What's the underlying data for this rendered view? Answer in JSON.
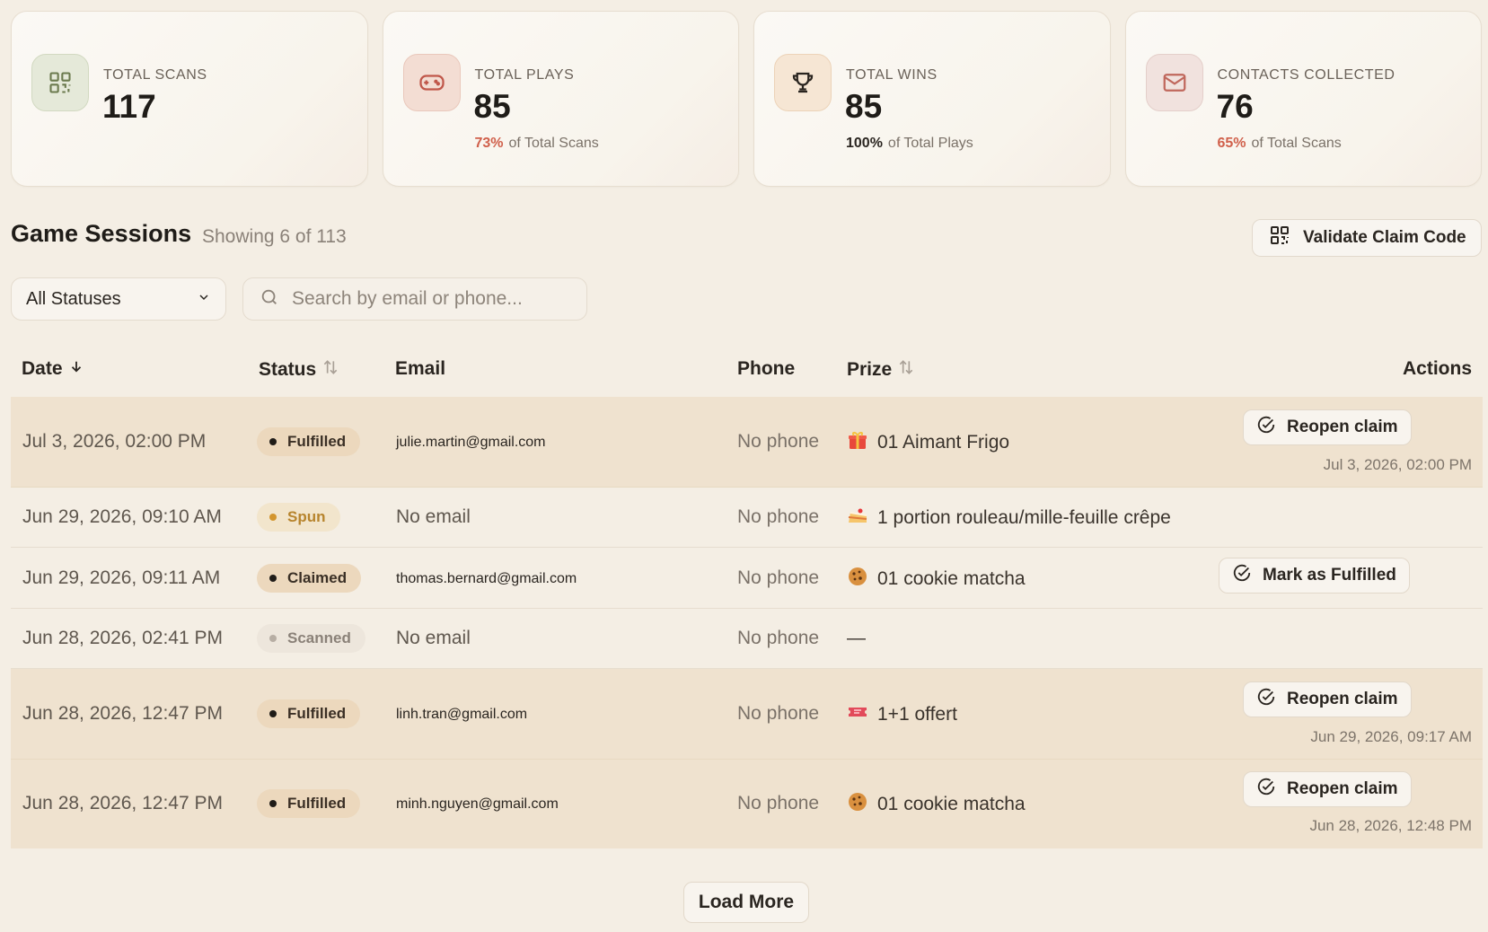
{
  "stats": [
    {
      "label": "TOTAL SCANS",
      "value": "117",
      "pct": "",
      "sub": "",
      "icon": "qr-code-icon"
    },
    {
      "label": "TOTAL PLAYS",
      "value": "85",
      "pct": "73%",
      "sub": "of Total Scans",
      "icon": "gamepad-icon"
    },
    {
      "label": "TOTAL WINS",
      "value": "85",
      "pct": "100%",
      "sub": "of Total Plays",
      "icon": "trophy-icon"
    },
    {
      "label": "CONTACTS COLLECTED",
      "value": "76",
      "pct": "65%",
      "sub": "of Total Scans",
      "icon": "mail-icon"
    }
  ],
  "sessions": {
    "title": "Game Sessions",
    "count": "Showing 6 of 113",
    "validate_label": "Validate Claim Code"
  },
  "filters": {
    "status_value": "All Statuses",
    "search_placeholder": "Search by email or phone..."
  },
  "table": {
    "headers": {
      "date": "Date",
      "status": "Status",
      "email": "Email",
      "phone": "Phone",
      "prize": "Prize",
      "actions": "Actions"
    },
    "rows": [
      {
        "date": "Jul 3, 2026, 02:00 PM",
        "status": "Fulfilled",
        "email": "julie.martin@gmail.com",
        "phone": "No phone",
        "prize": "01 Aimant Frigo",
        "prize_icon": "gift-emoji",
        "action": "Reopen claim",
        "action_date": "Jul 3, 2026, 02:00 PM"
      },
      {
        "date": "Jun 29, 2026, 09:10 AM",
        "status": "Spun",
        "email": "No email",
        "phone": "No phone",
        "prize": "1 portion rouleau/mille-feuille crêpe",
        "prize_icon": "cake-emoji",
        "action": "",
        "action_date": ""
      },
      {
        "date": "Jun 29, 2026, 09:11 AM",
        "status": "Claimed",
        "email": "thomas.bernard@gmail.com",
        "phone": "No phone",
        "prize": "01 cookie matcha",
        "prize_icon": "cookie-emoji",
        "action": "Mark as Fulfilled",
        "action_date": ""
      },
      {
        "date": "Jun 28, 2026, 02:41 PM",
        "status": "Scanned",
        "email": "No email",
        "phone": "No phone",
        "prize": "—",
        "prize_icon": "",
        "action": "",
        "action_date": ""
      },
      {
        "date": "Jun 28, 2026, 12:47 PM",
        "status": "Fulfilled",
        "email": "linh.tran@gmail.com",
        "phone": "No phone",
        "prize": "1+1 offert",
        "prize_icon": "ticket-emoji",
        "action": "Reopen claim",
        "action_date": "Jun 29, 2026, 09:17 AM"
      },
      {
        "date": "Jun 28, 2026, 12:47 PM",
        "status": "Fulfilled",
        "email": "minh.nguyen@gmail.com",
        "phone": "No phone",
        "prize": "01 cookie matcha",
        "prize_icon": "cookie-emoji",
        "action": "Reopen claim",
        "action_date": "Jun 28, 2026, 12:48 PM"
      }
    ]
  },
  "load_more": "Load More",
  "colors": {
    "background": "#f4eee4",
    "highlight_row": "#efe2cf",
    "accent_red": "#d0604b",
    "spun_amber": "#d3952d"
  }
}
